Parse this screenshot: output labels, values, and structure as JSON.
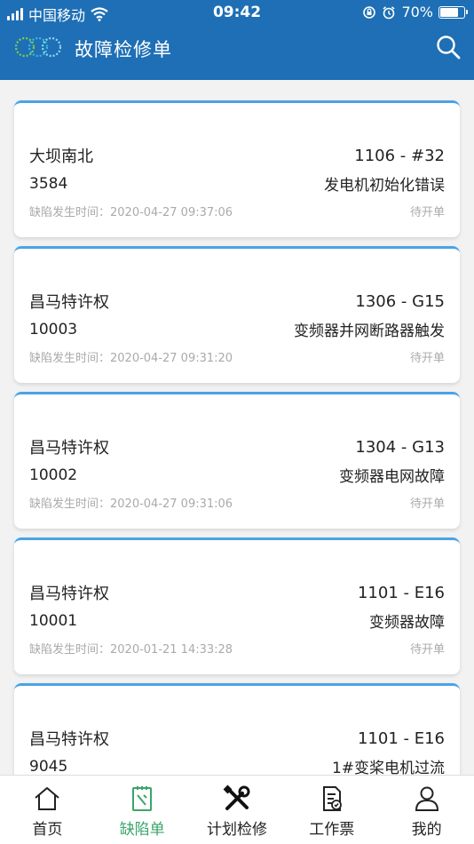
{
  "status_bar": {
    "carrier": "中国移动",
    "time": "09:42",
    "battery": "70%",
    "battery_level": 0.7
  },
  "header": {
    "title": "故障检修单"
  },
  "cards": [
    {
      "site": "大坝南北",
      "code": "1106 - #32",
      "id": "3584",
      "fault": "发电机初始化错误",
      "time_label": "缺陷发生时间：2020-04-27 09:37:06",
      "status": "待开单"
    },
    {
      "site": "昌马特许权",
      "code": "1306 - G15",
      "id": "10003",
      "fault": "变频器并网断路器触发",
      "time_label": "缺陷发生时间：2020-04-27 09:31:20",
      "status": "待开单"
    },
    {
      "site": "昌马特许权",
      "code": "1304 - G13",
      "id": "10002",
      "fault": "变频器电网故障",
      "time_label": "缺陷发生时间：2020-04-27 09:31:06",
      "status": "待开单"
    },
    {
      "site": "昌马特许权",
      "code": "1101 - E16",
      "id": "10001",
      "fault": "变频器故障",
      "time_label": "缺陷发生时间：2020-01-21 14:33:28",
      "status": "待开单"
    },
    {
      "site": "昌马特许权",
      "code": "1101 - E16",
      "id": "9045",
      "fault": "1#变桨电机过流",
      "time_label": "",
      "status": ""
    }
  ],
  "tabs": [
    {
      "label": "首页",
      "icon": "home-icon"
    },
    {
      "label": "缺陷单",
      "icon": "defect-form-icon"
    },
    {
      "label": "计划检修",
      "icon": "tools-icon"
    },
    {
      "label": "工作票",
      "icon": "work-ticket-icon"
    },
    {
      "label": "我的",
      "icon": "profile-icon"
    }
  ],
  "colors": {
    "header_bg": "#1e6fb5",
    "card_accent": "#4aa3e6",
    "active_tab": "#3aa56a"
  }
}
